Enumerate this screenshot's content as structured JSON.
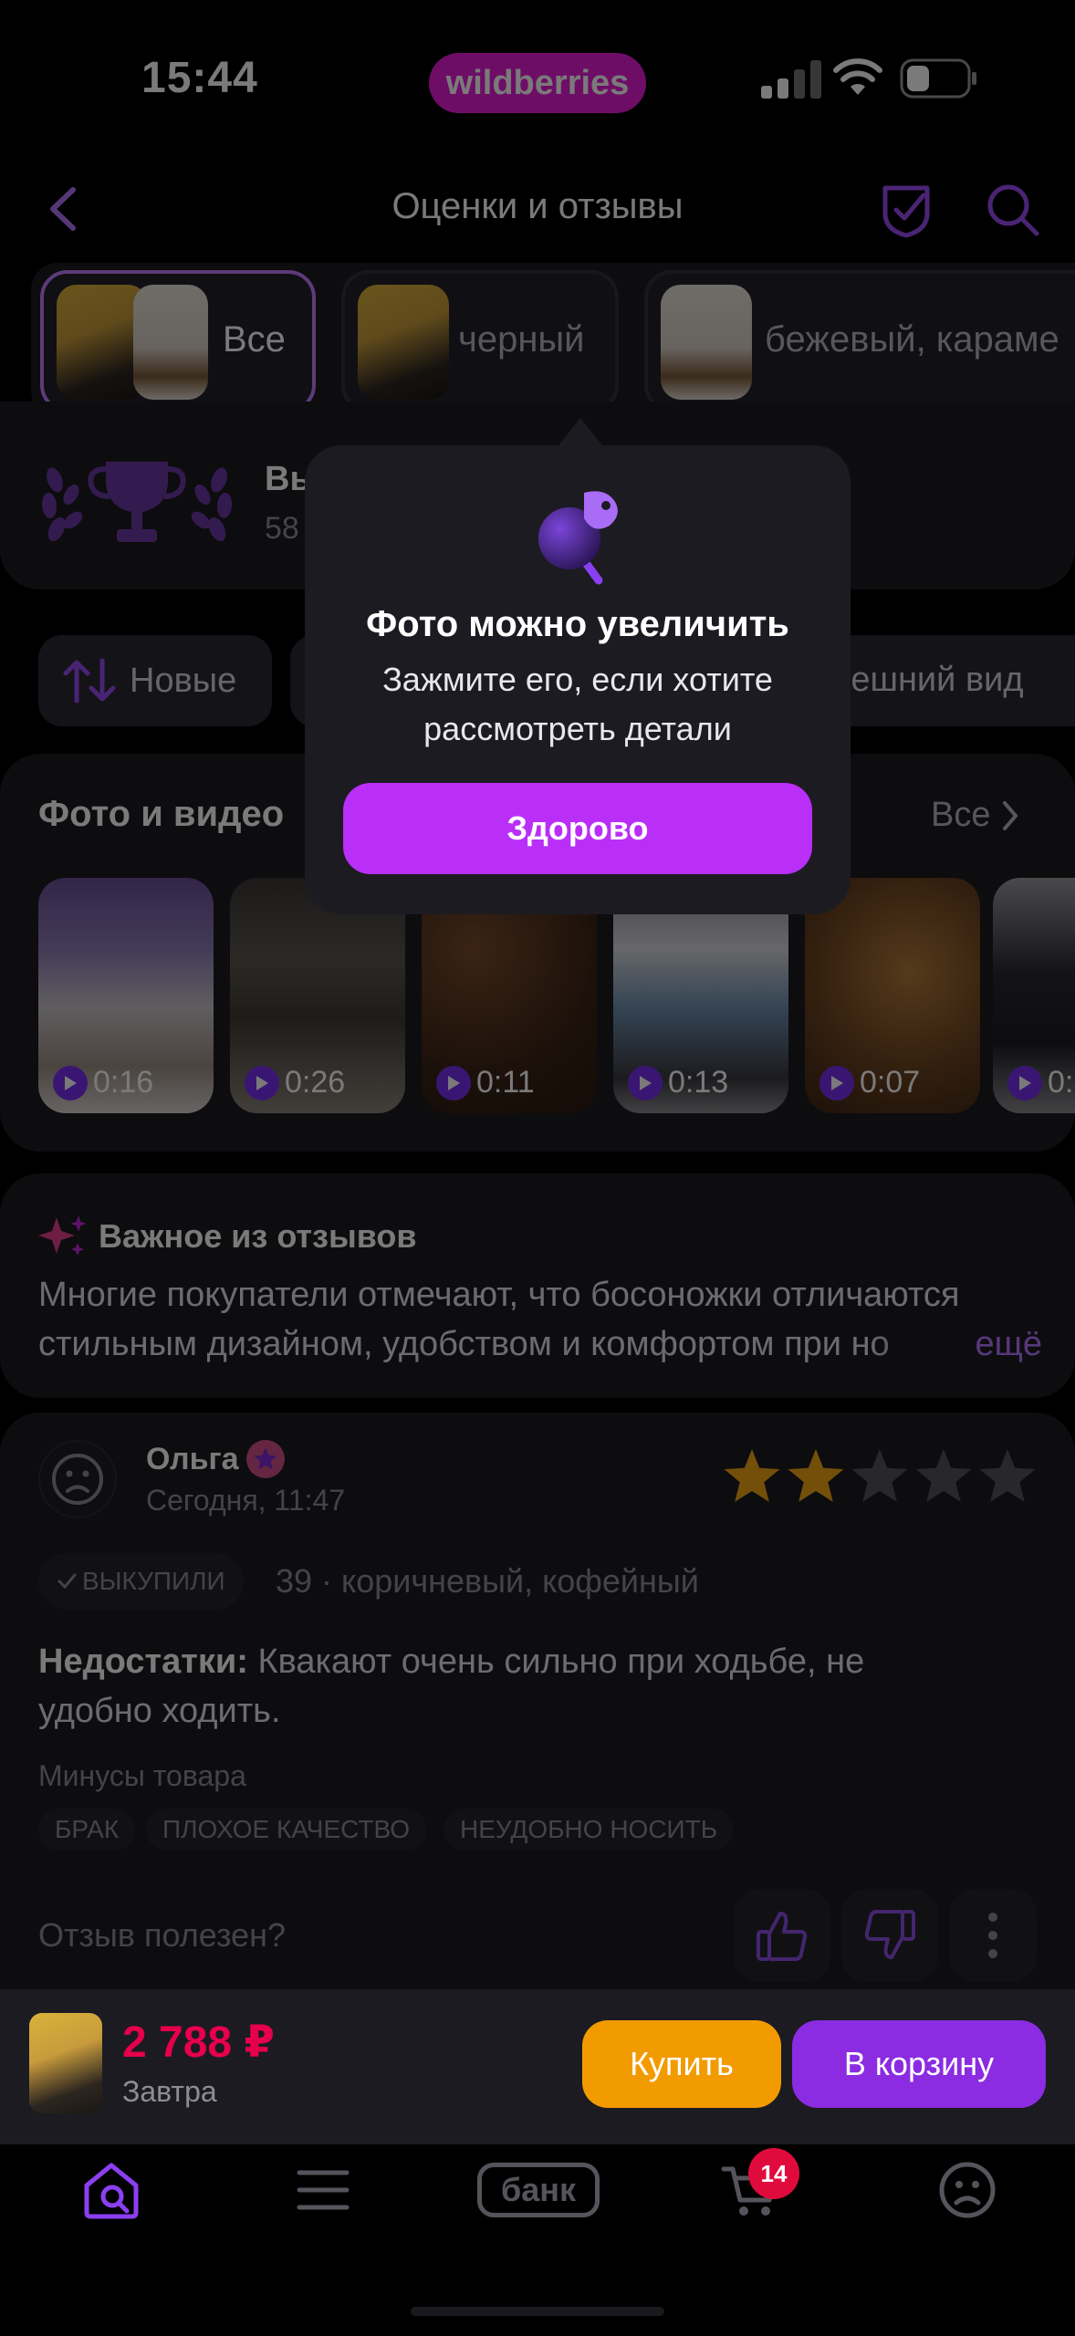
{
  "status_bar": {
    "time": "15:44",
    "brand": "wildberries"
  },
  "header": {
    "title": "Оценки и отзывы"
  },
  "variants": [
    {
      "label": "Все",
      "selected": true
    },
    {
      "label": "черный",
      "selected": false
    },
    {
      "label": "бежевый, караме",
      "selected": false
    }
  ],
  "rating_summary": {
    "title_fragment": "Вы",
    "subtitle_fragment": "58"
  },
  "sort": {
    "label": "Новые"
  },
  "filter_chip": {
    "label": "Внешний вид"
  },
  "photos_videos": {
    "title": "Фото и видео",
    "all_label": "Все",
    "videos": [
      {
        "duration": "0:16"
      },
      {
        "duration": "0:26"
      },
      {
        "duration": "0:11"
      },
      {
        "duration": "0:13"
      },
      {
        "duration": "0:07"
      },
      {
        "duration": "0:"
      }
    ]
  },
  "important": {
    "title": "Важное из отзывов",
    "text": "Многие покупатели отмечают, что босоножки отличаются стильным дизайном, удобством и комфортом при но",
    "more": "ещё"
  },
  "review": {
    "author": "Ольга",
    "date": "Сегодня, 11:47",
    "rating": 2,
    "rating_max": 5,
    "bought_badge": "ВЫКУПИЛИ",
    "variant": "39 · коричневый, кофейный",
    "cons_label": "Недостатки:",
    "cons_text": "Квакают очень сильно при ходьбе, не удобно ходить.",
    "minus_title": "Минусы товара",
    "tags": [
      "БРАК",
      "ПЛОХОЕ КАЧЕСТВО",
      "НЕУДОБНО НОСИТЬ"
    ],
    "helpful_question": "Отзыв полезен?"
  },
  "tooltip": {
    "title": "Фото можно увеличить",
    "text_line1": "Зажмите его, если хотите",
    "text_line2": "рассмотреть детали",
    "button": "Здорово"
  },
  "purchase": {
    "price": "2 788 ₽",
    "delivery": "Завтра",
    "buy": "Купить",
    "add_to_cart": "В корзину"
  },
  "bottom_nav": {
    "bank_label": "банк",
    "cart_badge": "14"
  },
  "colors": {
    "brand_pink": "#cb11ab",
    "accent_purple": "#b92ff7",
    "price_red": "#e6004c",
    "buy_orange": "#f29b00",
    "cart_purple": "#8b2be2",
    "star_gold": "#f2a516"
  }
}
